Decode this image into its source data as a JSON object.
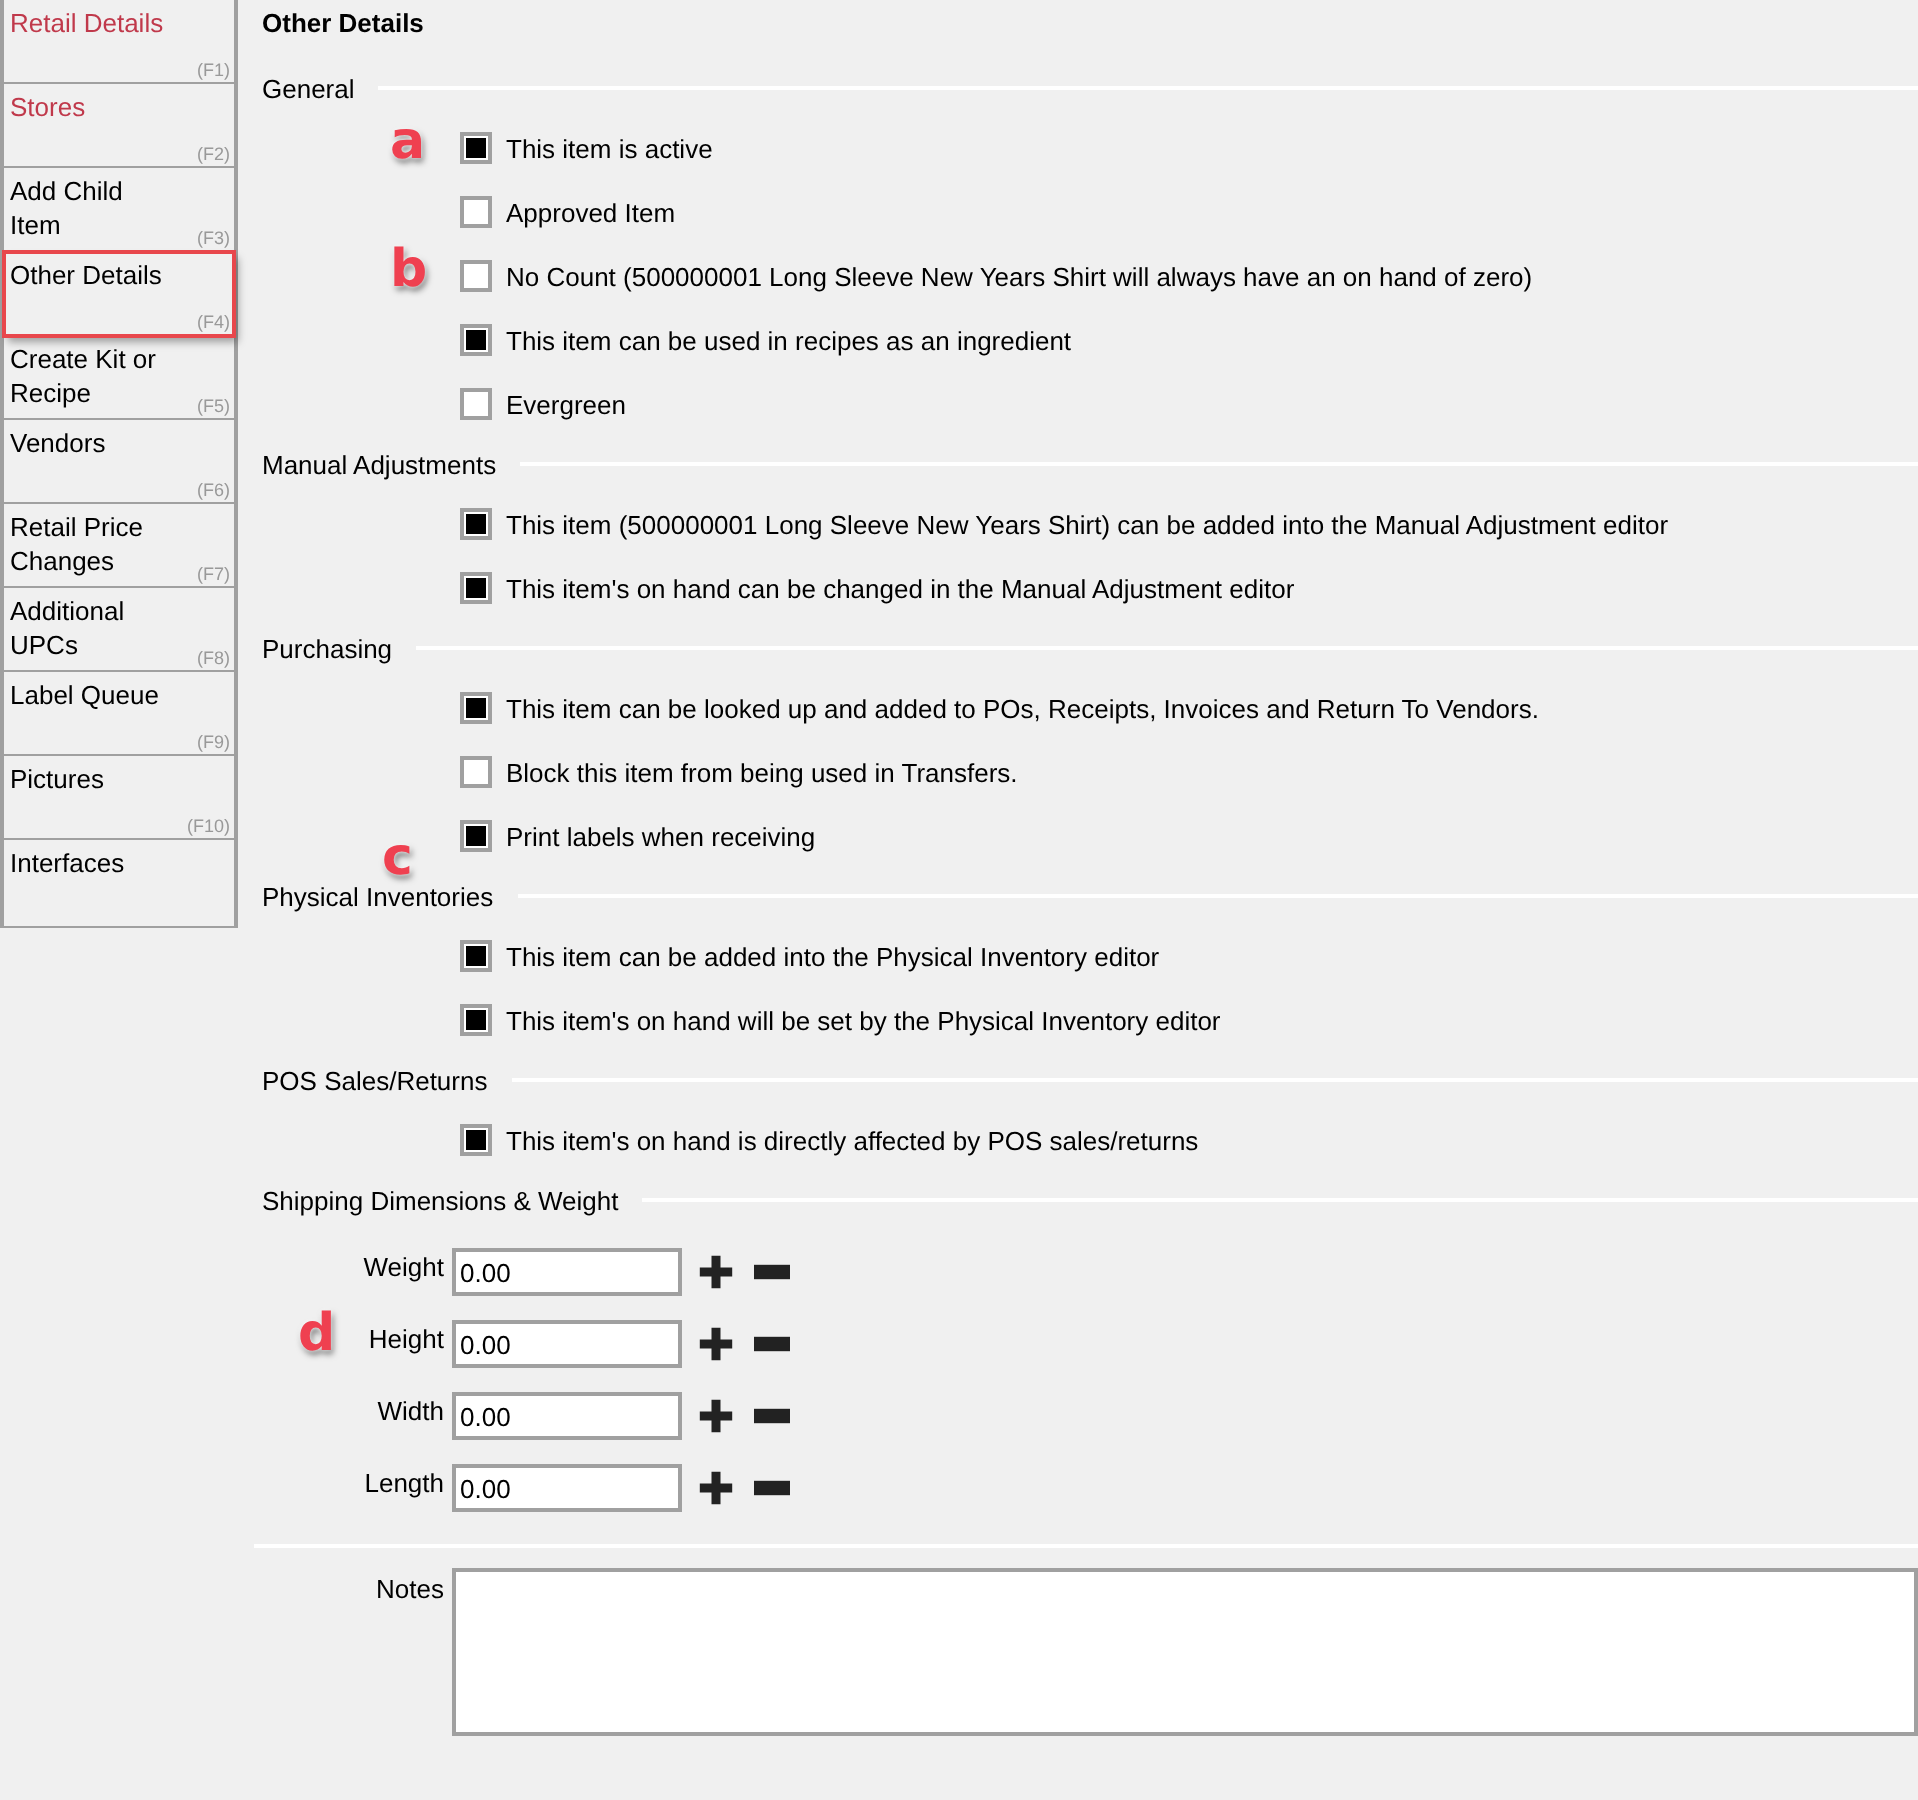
{
  "sidebar": {
    "items": [
      {
        "label": "Retail Details",
        "key": "(F1)",
        "color": "#c0394b",
        "selected": false
      },
      {
        "label": "Stores",
        "key": "(F2)",
        "color": "#c0394b",
        "selected": false
      },
      {
        "label": "Add Child Item",
        "key": "(F3)",
        "color": "#000000",
        "selected": false
      },
      {
        "label": "Other Details",
        "key": "(F4)",
        "color": "#000000",
        "selected": true
      },
      {
        "label": "Create Kit or Recipe",
        "key": "(F5)",
        "color": "#000000",
        "selected": false
      },
      {
        "label": "Vendors",
        "key": "(F6)",
        "color": "#000000",
        "selected": false
      },
      {
        "label": "Retail Price Changes",
        "key": "(F7)",
        "color": "#000000",
        "selected": false
      },
      {
        "label": "Additional UPCs",
        "key": "(F8)",
        "color": "#000000",
        "selected": false
      },
      {
        "label": "Label Queue",
        "key": "(F9)",
        "color": "#000000",
        "selected": false
      },
      {
        "label": "Pictures",
        "key": "(F10)",
        "color": "#000000",
        "selected": false
      },
      {
        "label": "Interfaces",
        "selected": false,
        "color": "#000000"
      }
    ]
  },
  "title": "Other Details",
  "sections": [
    {
      "title": "General",
      "options": [
        {
          "label": "This item is active",
          "checked": true,
          "callout": "a"
        },
        {
          "label": "Approved Item",
          "checked": false
        },
        {
          "label": "No Count (500000001 Long Sleeve New Years Shirt will always have an on hand of zero)",
          "checked": false,
          "callout": "b"
        },
        {
          "label": "This item can be used in recipes as an ingredient",
          "checked": true
        },
        {
          "label": "Evergreen",
          "checked": false
        }
      ]
    },
    {
      "title": "Manual Adjustments",
      "options": [
        {
          "label": "This item (500000001 Long Sleeve New Years Shirt) can be added into the Manual Adjustment editor",
          "checked": true
        },
        {
          "label": "This item's on hand can be changed in the Manual Adjustment editor",
          "checked": true
        }
      ]
    },
    {
      "title": "Purchasing",
      "options": [
        {
          "label": "This item can be looked up and added to POs, Receipts, Invoices and Return To Vendors.",
          "checked": true
        },
        {
          "label": "Block this item from being used in Transfers.",
          "checked": false
        },
        {
          "label": "Print labels when receiving",
          "checked": true
        }
      ]
    },
    {
      "title": "Physical Inventories",
      "callout": "c",
      "options": [
        {
          "label": "This item can be added into the Physical Inventory editor",
          "checked": true
        },
        {
          "label": "This item's on hand will be set by the Physical Inventory editor",
          "checked": true
        }
      ]
    },
    {
      "title": "POS Sales/Returns",
      "options": [
        {
          "label": "This item's on hand is directly affected by POS sales/returns",
          "checked": true
        }
      ]
    }
  ],
  "shipping": {
    "title": "Shipping Dimensions & Weight",
    "callout": "d",
    "fields": [
      {
        "label": "Weight",
        "value": "0.00"
      },
      {
        "label": "Height",
        "value": "0.00"
      },
      {
        "label": "Width",
        "value": "0.00"
      },
      {
        "label": "Length",
        "value": "0.00"
      }
    ]
  },
  "notes": {
    "label": "Notes"
  }
}
